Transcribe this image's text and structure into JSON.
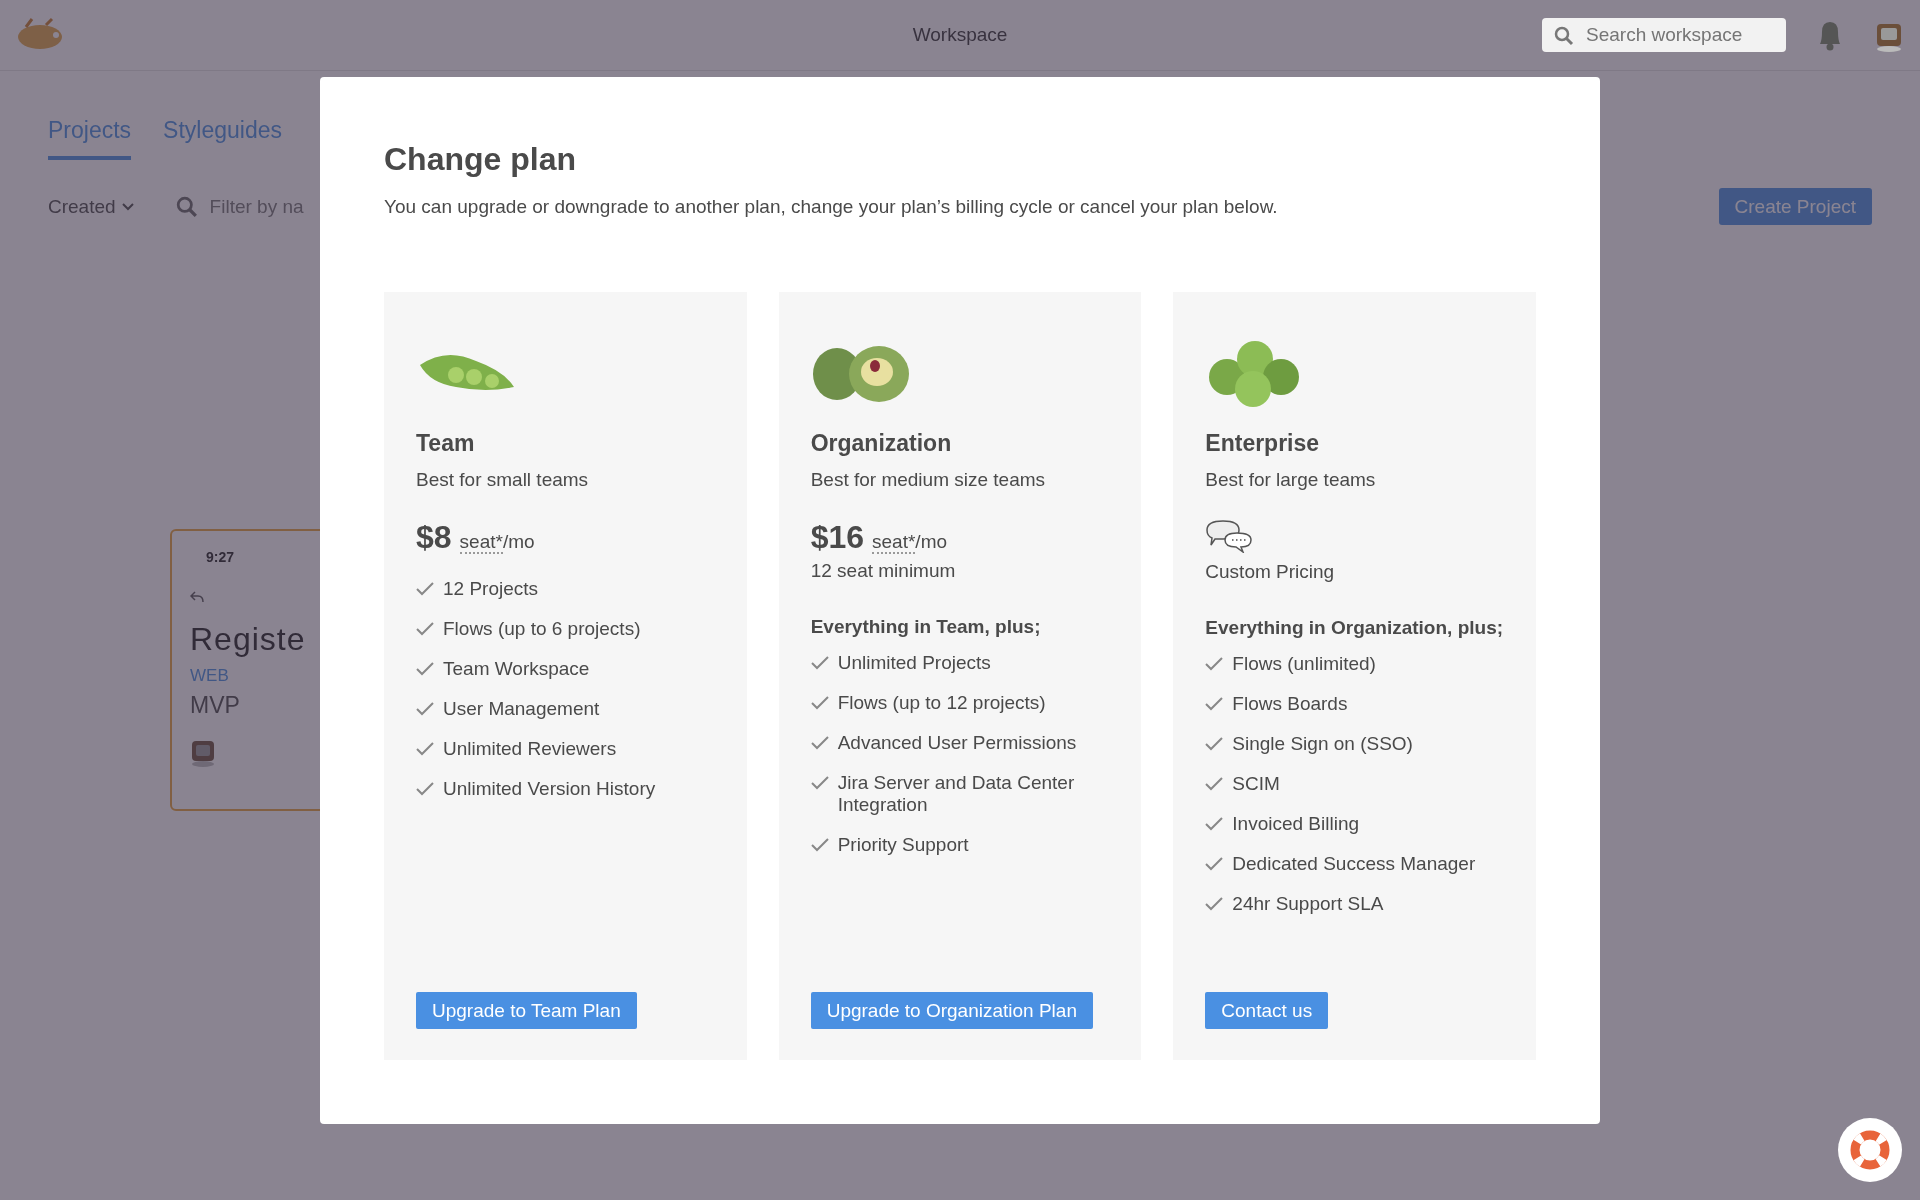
{
  "top_bar": {
    "title": "Workspace",
    "search": {
      "placeholder": "Search workspace"
    }
  },
  "tabs": [
    {
      "label": "Projects",
      "selected": true
    },
    {
      "label": "Styleguides",
      "selected": false
    }
  ],
  "toolbar": {
    "sort": "Created",
    "filter": {
      "placeholder": "Filter by na"
    },
    "create_button": "Create Project"
  },
  "project_card": {
    "time": "9:27",
    "title": "Registe",
    "platform": "WEB",
    "name": "MVP"
  },
  "modal": {
    "title": "Change plan",
    "description": "You can upgrade or downgrade to another plan, change your plan’s billing cycle or cancel your plan below.",
    "plans": [
      {
        "kind": "priced",
        "name": "Team",
        "tagline": "Best for small teams",
        "price": "$8",
        "unit_term": "seat*",
        "unit_suffix": "/mo",
        "features": [
          "12 Projects",
          "Flows (up to 6 projects)",
          "Team Workspace",
          "User Management",
          "Unlimited Reviewers",
          "Unlimited Version History"
        ],
        "button": "Upgrade to Team Plan"
      },
      {
        "kind": "priced",
        "name": "Organization",
        "tagline": "Best for medium size teams",
        "price": "$16",
        "unit_term": "seat*",
        "unit_suffix": "/mo",
        "minimum": "12 seat minimum",
        "features_heading": "Everything in Team, plus;",
        "features": [
          "Unlimited Projects",
          "Flows (up to 12 projects)",
          "Advanced User Permissions",
          "Jira Server and Data Center Integration",
          "Priority Support"
        ],
        "button": "Upgrade to Organization Plan"
      },
      {
        "kind": "custom",
        "name": "Enterprise",
        "tagline": "Best for large teams",
        "price": "Custom Pricing",
        "features_heading": "Everything in Organization, plus;",
        "features": [
          "Flows (unlimited)",
          "Flows Boards",
          "Single Sign on (SSO)",
          "SCIM",
          "Invoiced Billing",
          "Dedicated Success Manager",
          "24hr Support SLA"
        ],
        "button": "Contact us"
      }
    ]
  }
}
